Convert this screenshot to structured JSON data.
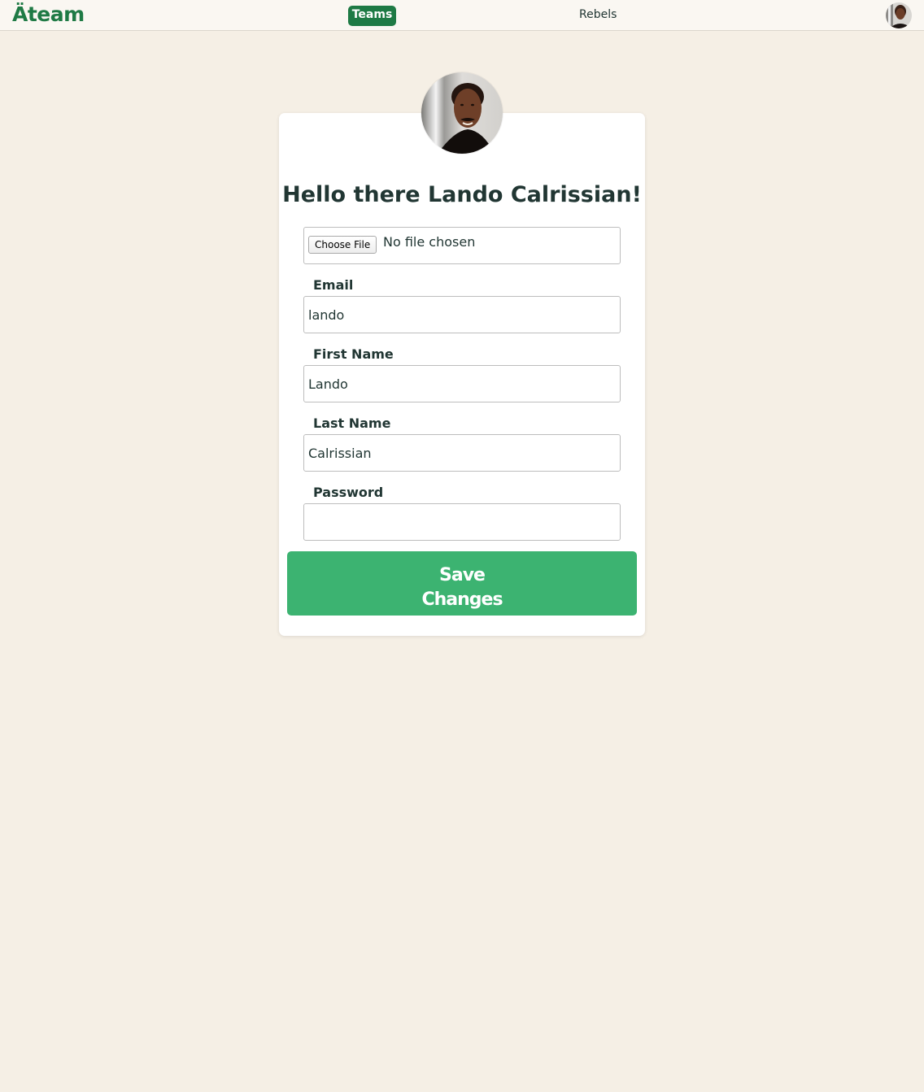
{
  "nav": {
    "logo": "Äteam",
    "teams_label": "Teams",
    "rebels_label": "Rebels",
    "avatar_icon": "user-avatar-icon"
  },
  "profile": {
    "greeting": "Hello there Lando Calrissian!",
    "file_button_label": "Choose File",
    "file_status": "No file chosen",
    "email_label": "Email",
    "email_value": "lando",
    "first_name_label": "First Name",
    "first_name_value": "Lando",
    "last_name_label": "Last Name",
    "last_name_value": "Calrissian",
    "password_label": "Password",
    "password_value": "",
    "save_line1": "Save",
    "save_line2": "Changes"
  },
  "colors": {
    "background": "#f5efe5",
    "brand_green": "#1e7a45",
    "save_green": "#3cb371",
    "text": "#213633"
  }
}
